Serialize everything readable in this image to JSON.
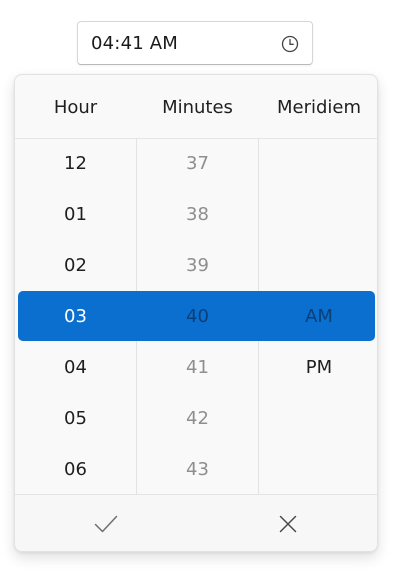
{
  "time_input": {
    "value": "04:41 AM",
    "icon": "clock-icon"
  },
  "picker": {
    "headers": {
      "hour": "Hour",
      "minutes": "Minutes",
      "meridiem": "Meridiem"
    },
    "hours": [
      "12",
      "01",
      "02",
      "03",
      "04",
      "05",
      "06"
    ],
    "minutes": [
      "37",
      "38",
      "39",
      "40",
      "41",
      "42",
      "43"
    ],
    "meridiem": [
      "AM",
      "PM"
    ],
    "selected": {
      "hour": "03",
      "minute": "40",
      "meridiem": "AM"
    },
    "selection_color": "#0a6fce"
  },
  "footer": {
    "accept_icon": "checkmark-icon",
    "dismiss_icon": "close-icon"
  }
}
